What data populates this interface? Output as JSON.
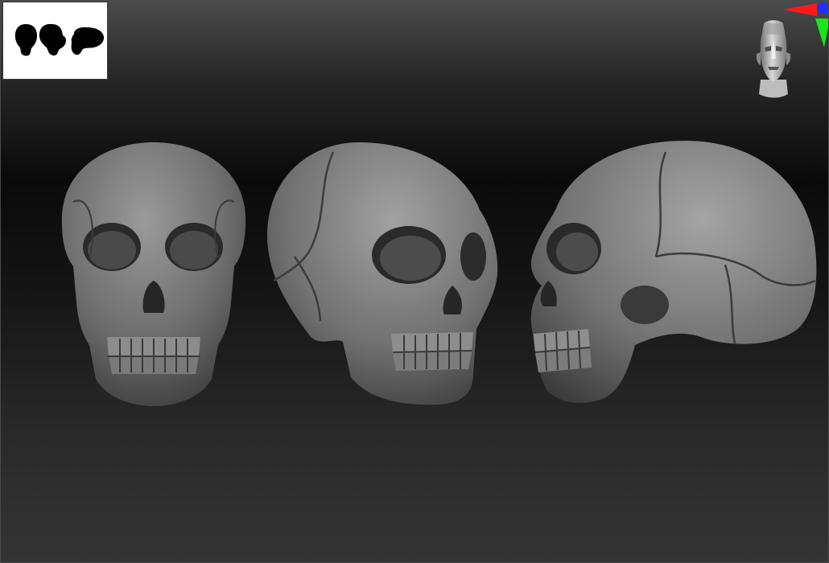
{
  "app": {
    "background_gradient": [
      "#4b4b4b",
      "#0a0a0a",
      "#353535"
    ]
  },
  "thumbnail": {
    "icon_names": [
      "skull-front-silhouette-icon",
      "skull-three-quarter-silhouette-icon",
      "skull-side-silhouette-icon"
    ]
  },
  "navigation": {
    "icon_name": "navigation-head-icon"
  },
  "axis_gizmo": {
    "x_color": "#ff1a1a",
    "y_color": "#19e619",
    "z_color": "#1f2fff"
  },
  "models": [
    {
      "view": "front",
      "icon_name": "skull-front-icon"
    },
    {
      "view": "three-quarter",
      "icon_name": "skull-three-quarter-icon"
    },
    {
      "view": "side",
      "icon_name": "skull-side-icon"
    }
  ]
}
